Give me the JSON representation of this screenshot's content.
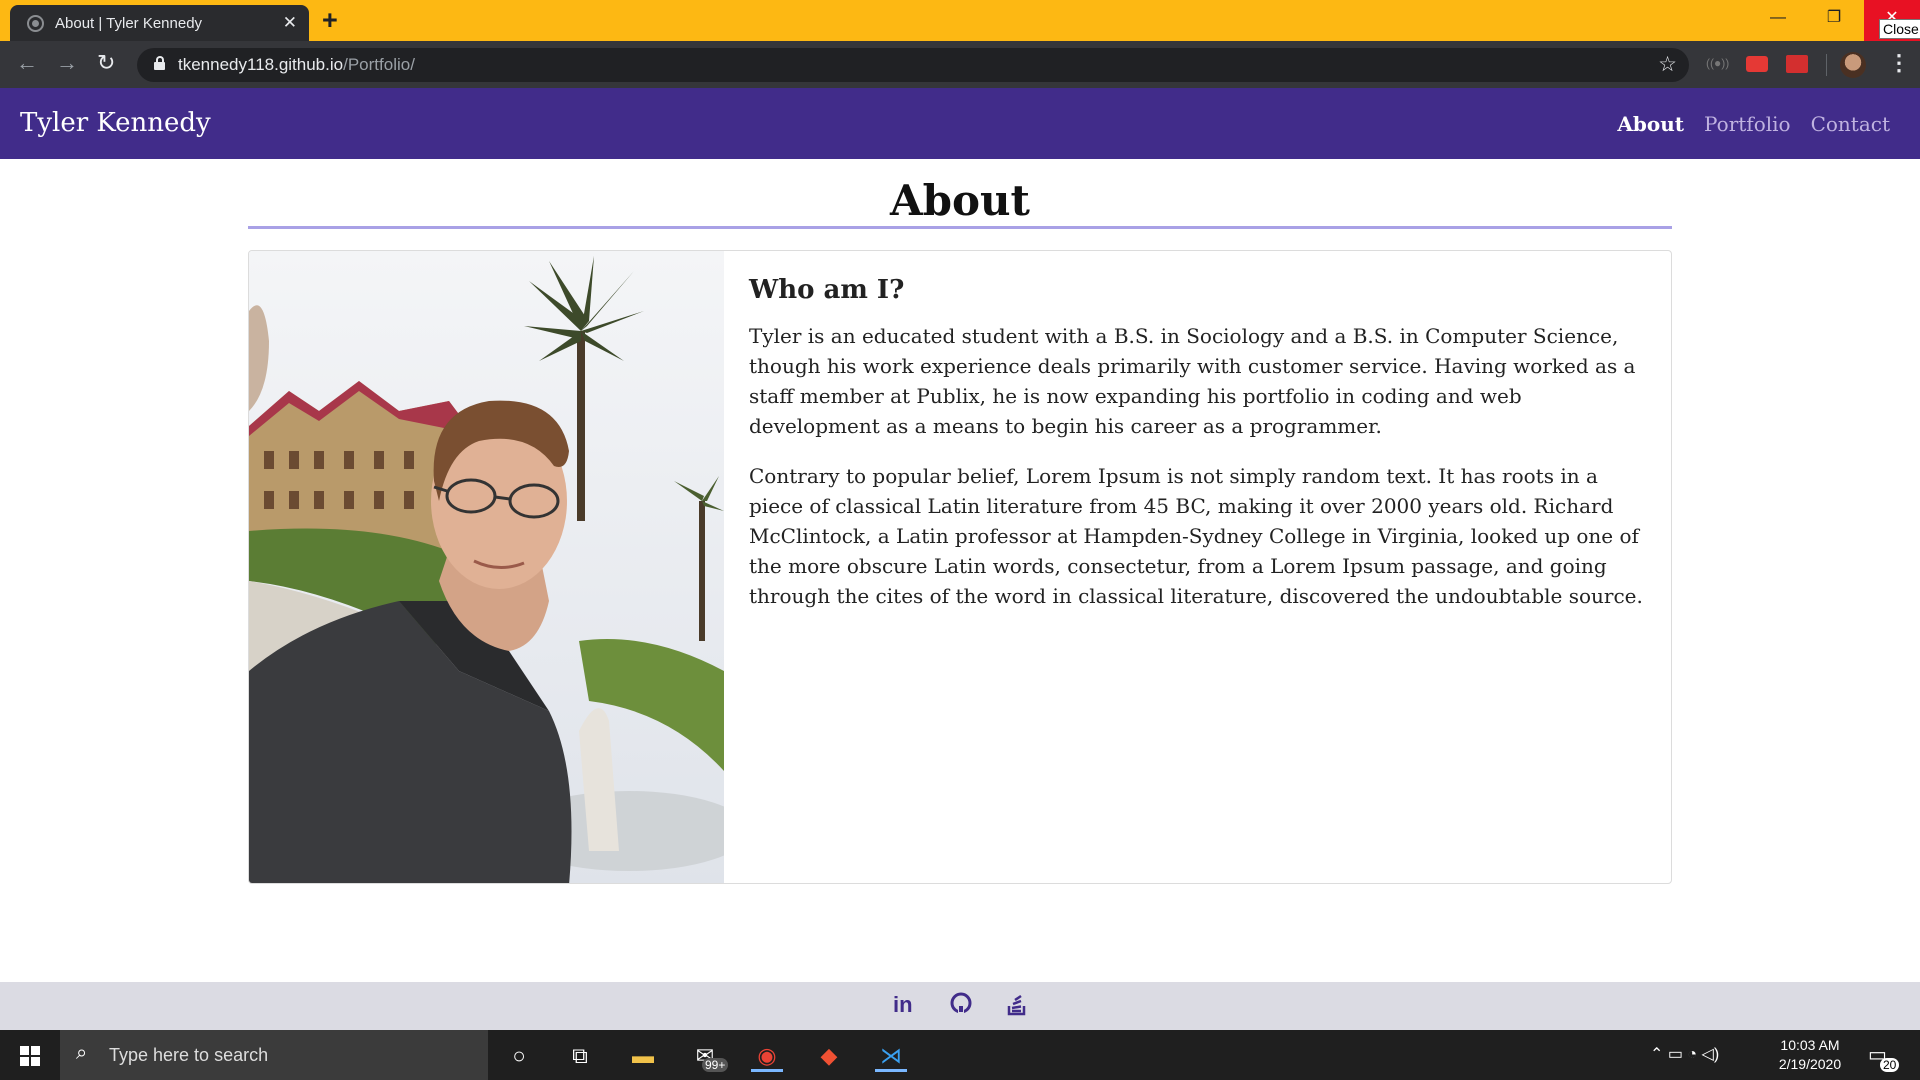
{
  "browser": {
    "tab_title": "About | Tyler Kennedy",
    "close_tab": "✕",
    "new_tab": "+",
    "url_host": "tkennedy118.github.io",
    "url_path": "/Portfolio/",
    "tooltip": "Close",
    "window_min": "—",
    "window_max": "❐",
    "window_close": "✕"
  },
  "site": {
    "brand": "Tyler Kennedy",
    "nav": [
      {
        "label": "About",
        "active": true
      },
      {
        "label": "Portfolio",
        "active": false
      },
      {
        "label": "Contact",
        "active": false
      }
    ],
    "page_heading": "About",
    "card": {
      "title": "Who am I?",
      "paragraphs": [
        "Tyler is an educated student with a B.S. in Sociology and a B.S. in Computer Science, though his work experience deals primarily with customer service. Having worked as a staff member at Publix, he is now expanding his portfolio in coding and web development as a means to begin his career as a programmer.",
        "Contrary to popular belief, Lorem Ipsum is not simply random text. It has roots in a piece of classical Latin literature from 45 BC, making it over 2000 years old. Richard McClintock, a Latin professor at Hampden-Sydney College in Virginia, looked up one of the more obscure Latin words, consectetur, from a Lorem Ipsum passage, and going through the cites of the word in classical literature, discovered the undoubtable source."
      ]
    },
    "footer_icons": [
      "linkedin-icon",
      "github-icon",
      "stack-overflow-icon"
    ],
    "footer_linkedin_text": "in",
    "colors": {
      "brand_purple": "#412c8a",
      "rule": "#a9a1e6",
      "titlebar": "#fdb813"
    }
  },
  "taskbar": {
    "search_placeholder": "Type here to search",
    "mail_badge": "99+",
    "time": "10:03 AM",
    "date": "2/19/2020",
    "notification_count": "20"
  }
}
